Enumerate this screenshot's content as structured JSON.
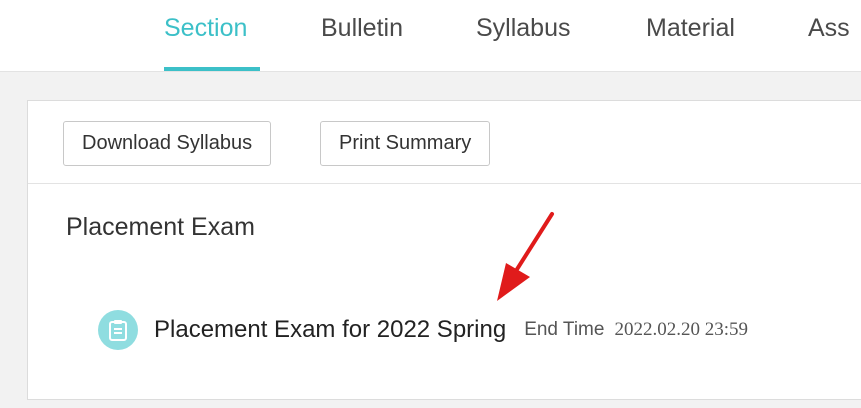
{
  "tabs": [
    {
      "label": "Section",
      "active": true
    },
    {
      "label": "Bulletin",
      "active": false
    },
    {
      "label": "Syllabus",
      "active": false
    },
    {
      "label": "Material",
      "active": false
    },
    {
      "label": "Ass",
      "active": false
    }
  ],
  "toolbar": {
    "download_label": "Download Syllabus",
    "print_label": "Print Summary"
  },
  "section": {
    "heading": "Placement Exam",
    "exam": {
      "icon": "clipboard-icon",
      "title": "Placement Exam for 2022 Spring",
      "end_label": "End Time",
      "end_value": "2022.02.20 23:59"
    }
  },
  "colors": {
    "accent": "#3cc0c8",
    "icon_bg": "#8fdde0",
    "annotation_arrow": "#e01b1b"
  }
}
